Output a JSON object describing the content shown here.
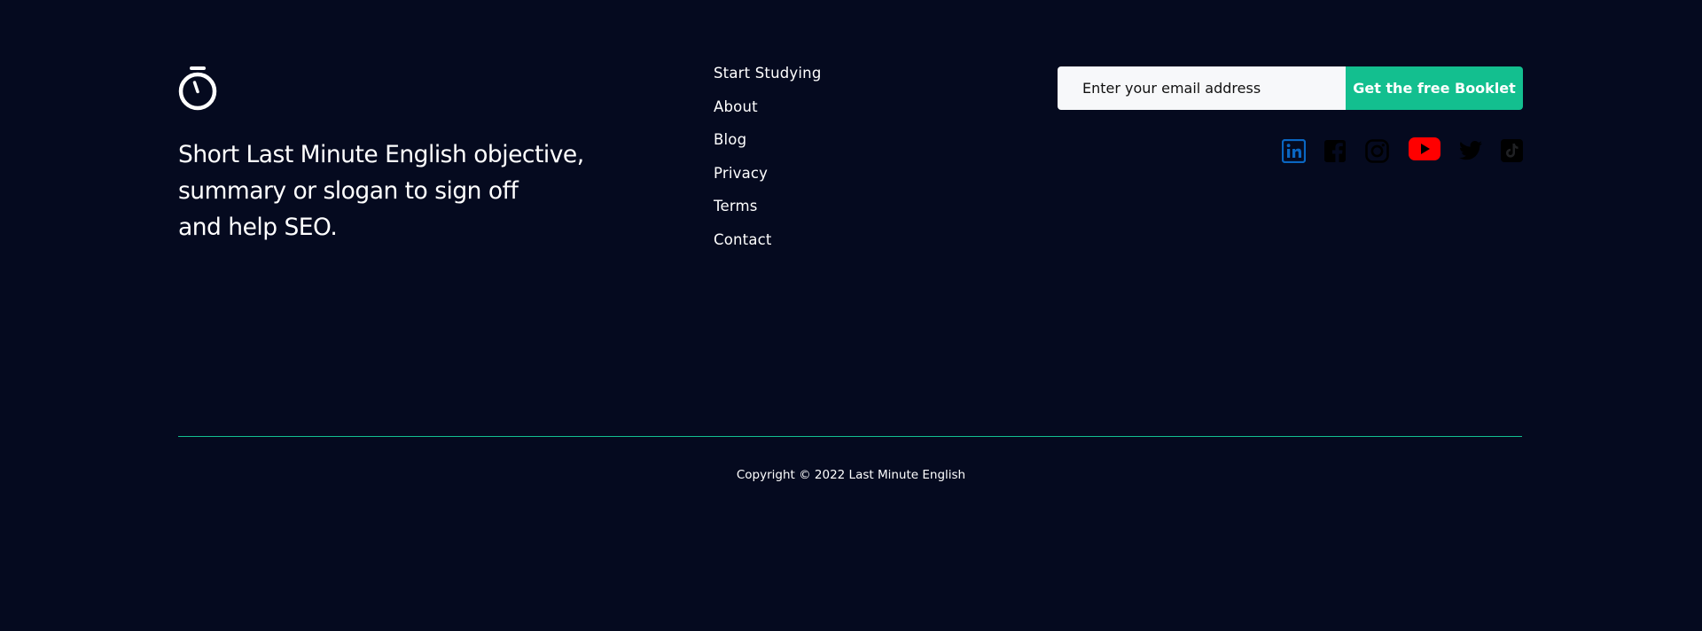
{
  "brand": {
    "logo_icon": "stopwatch-icon",
    "slogan_lines": [
      "Short Last Minute English objective,",
      "summary or slogan to sign off",
      "and help SEO."
    ]
  },
  "nav": {
    "items": [
      {
        "label": "Start Studying"
      },
      {
        "label": "About"
      },
      {
        "label": "Blog"
      },
      {
        "label": "Privacy"
      },
      {
        "label": "Terms"
      },
      {
        "label": "Contact"
      }
    ]
  },
  "subscribe": {
    "email_placeholder": "Enter your email address",
    "button_label": "Get the free Booklet"
  },
  "social": {
    "icons": [
      "linkedin-icon",
      "facebook-icon",
      "instagram-icon",
      "youtube-icon",
      "twitter-icon",
      "tiktok-icon"
    ]
  },
  "footer": {
    "copyright": "Copyright © 2022 Last Minute English"
  },
  "colors": {
    "background": "#050a1f",
    "accent": "#13bf8f",
    "linkedin": "#0a66c2",
    "youtube": "#ff0000",
    "icon_dark": "#000000"
  }
}
